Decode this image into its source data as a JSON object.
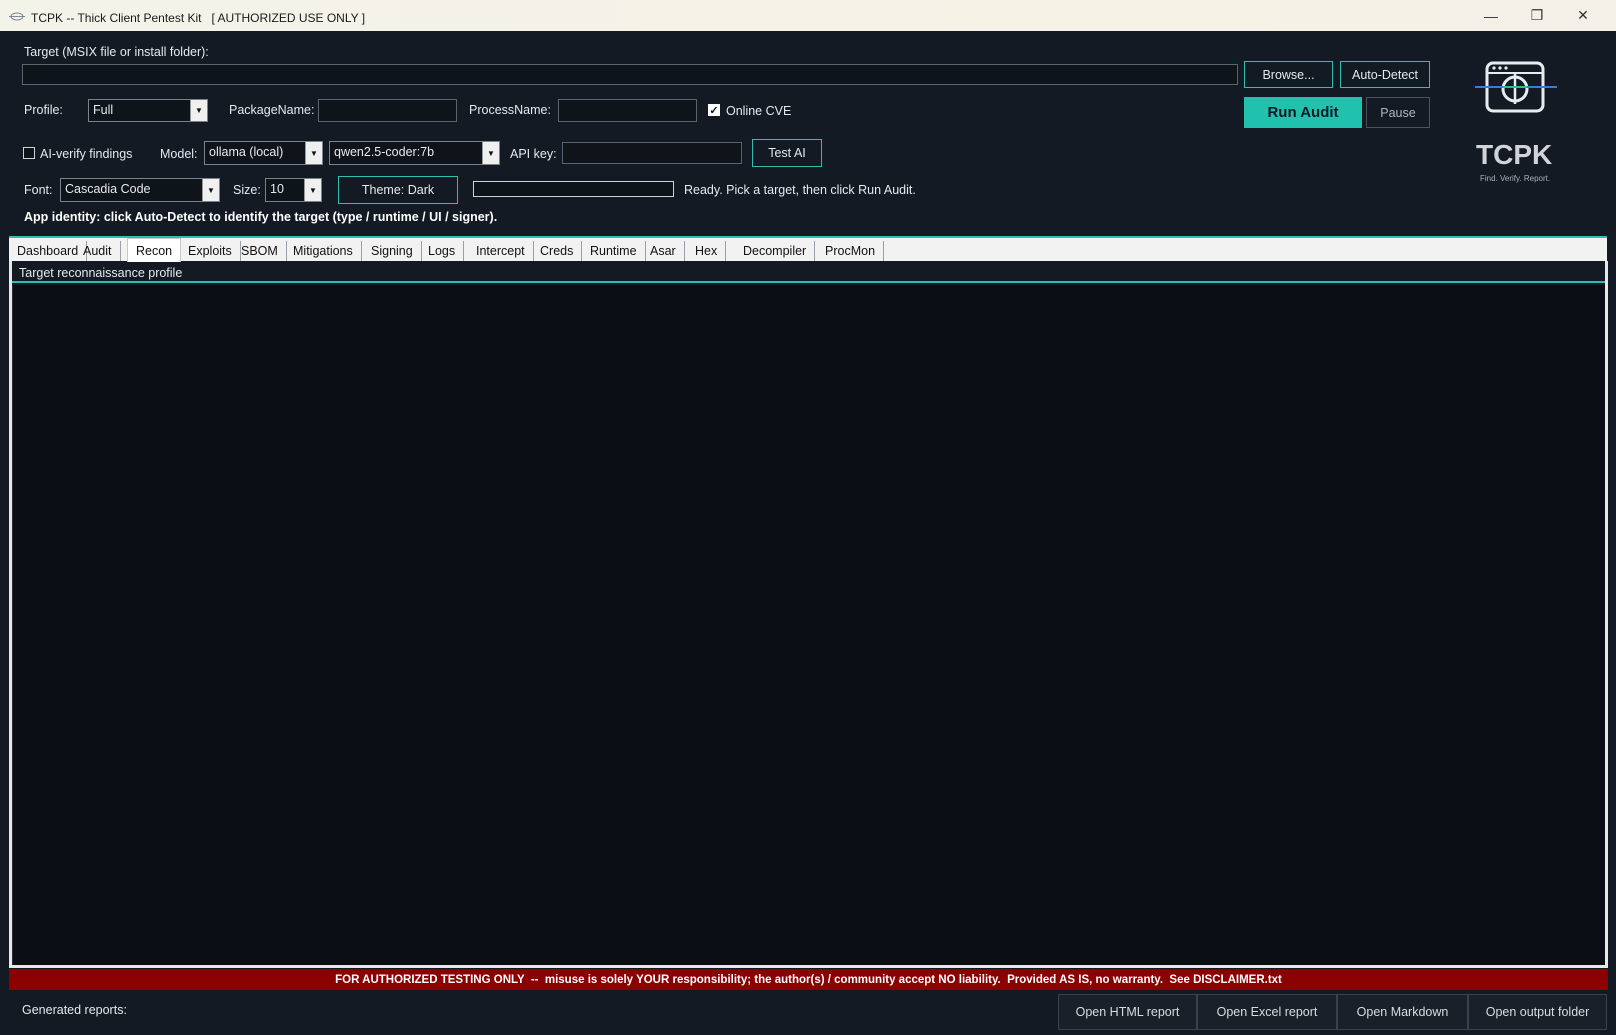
{
  "window": {
    "title": "TCPK -- Thick Client Pentest Kit   [ AUTHORIZED USE ONLY ]",
    "minimize_glyph": "—",
    "restore_glyph": "❐",
    "close_glyph": "✕"
  },
  "target": {
    "label": "Target (MSIX file or install folder):",
    "value": "",
    "browse_label": "Browse...",
    "autodetect_label": "Auto-Detect"
  },
  "profile": {
    "label": "Profile:",
    "selected": "Full",
    "package_label": "PackageName:",
    "package_value": "",
    "process_label": "ProcessName:",
    "process_value": "",
    "online_cve_label": "Online CVE",
    "online_cve_checked": true
  },
  "actions": {
    "run_label": "Run Audit",
    "pause_label": "Pause"
  },
  "ai": {
    "verify_label": "AI-verify findings",
    "verify_checked": false,
    "model_label": "Model:",
    "provider_selected": "ollama (local)",
    "model_selected": "qwen2.5-coder:7b",
    "apikey_label": "API key:",
    "apikey_value": "",
    "test_label": "Test AI"
  },
  "appearance": {
    "font_label": "Font:",
    "font_selected": "Cascadia Code",
    "size_label": "Size:",
    "size_selected": "10",
    "theme_label": "Theme: Dark",
    "progress": 0,
    "status": "Ready. Pick a target, then click Run Audit."
  },
  "identity_hint": "App identity: click Auto-Detect to identify the target (type / runtime / UI / signer).",
  "brand": {
    "name": "TCPK",
    "tagline": "Find. Verify. Report."
  },
  "tabs": [
    {
      "label": "Dashboard"
    },
    {
      "label": "Audit"
    },
    {
      "label": "Recon"
    },
    {
      "label": "Exploits"
    },
    {
      "label": "SBOM"
    },
    {
      "label": "Mitigations"
    },
    {
      "label": "Signing"
    },
    {
      "label": "Logs"
    },
    {
      "label": "Intercept"
    },
    {
      "label": "Creds"
    },
    {
      "label": "Runtime"
    },
    {
      "label": "Asar"
    },
    {
      "label": "Hex"
    },
    {
      "label": "Decompiler"
    },
    {
      "label": "ProcMon"
    }
  ],
  "active_tab": "Recon",
  "panel": {
    "header": "Target reconnaissance profile"
  },
  "disclaimer": "FOR AUTHORIZED TESTING ONLY  --  misuse is solely YOUR responsibility; the author(s) / community accept NO liability.  Provided AS IS, no warranty.  See DISCLAIMER.txt",
  "footer": {
    "reports_label": "Generated reports:",
    "open_html": "Open HTML report",
    "open_excel": "Open Excel report",
    "open_markdown": "Open Markdown",
    "open_folder": "Open output folder"
  },
  "colors": {
    "accent": "#21c2ad",
    "background": "#141a23",
    "content_bg": "#0b0f15",
    "disclaimer_bg": "#8b0000"
  }
}
